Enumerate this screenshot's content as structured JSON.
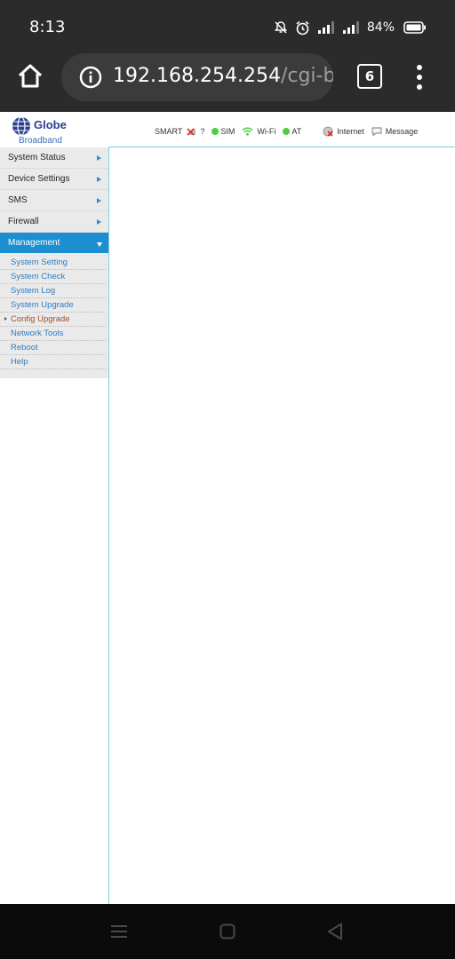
{
  "status_bar": {
    "time": "8:13",
    "battery": "84%",
    "icons": [
      "mute-bell-icon",
      "alarm-icon",
      "signal-icon",
      "signal-icon",
      "battery-icon"
    ]
  },
  "browser": {
    "url_host": "192.168.254.254",
    "url_path": "/cgi-bi",
    "tab_count": "6"
  },
  "header": {
    "brand": "Globe",
    "brand_sub": "Broadband",
    "carrier": "SMART",
    "carrier_status": "?",
    "sim_label": "SIM",
    "wifi_label": "Wi-Fi",
    "at_label": "AT",
    "internet_label": "Internet",
    "message_label": "Message",
    "colors": {
      "ok_green": "#4ccf3f",
      "accent": "#1d8fd0",
      "link": "#2f7cc2"
    }
  },
  "sidebar": {
    "items": [
      {
        "label": "System Status"
      },
      {
        "label": "Device Settings"
      },
      {
        "label": "SMS"
      },
      {
        "label": "Firewall"
      },
      {
        "label": "Management",
        "expanded": true
      }
    ],
    "management_subitems": [
      {
        "label": "System Setting"
      },
      {
        "label": "System Check"
      },
      {
        "label": "System Log"
      },
      {
        "label": "System Upgrade"
      },
      {
        "label": "Config Upgrade",
        "current": true
      },
      {
        "label": "Network Tools"
      },
      {
        "label": "Reboot"
      },
      {
        "label": "Help"
      }
    ]
  }
}
